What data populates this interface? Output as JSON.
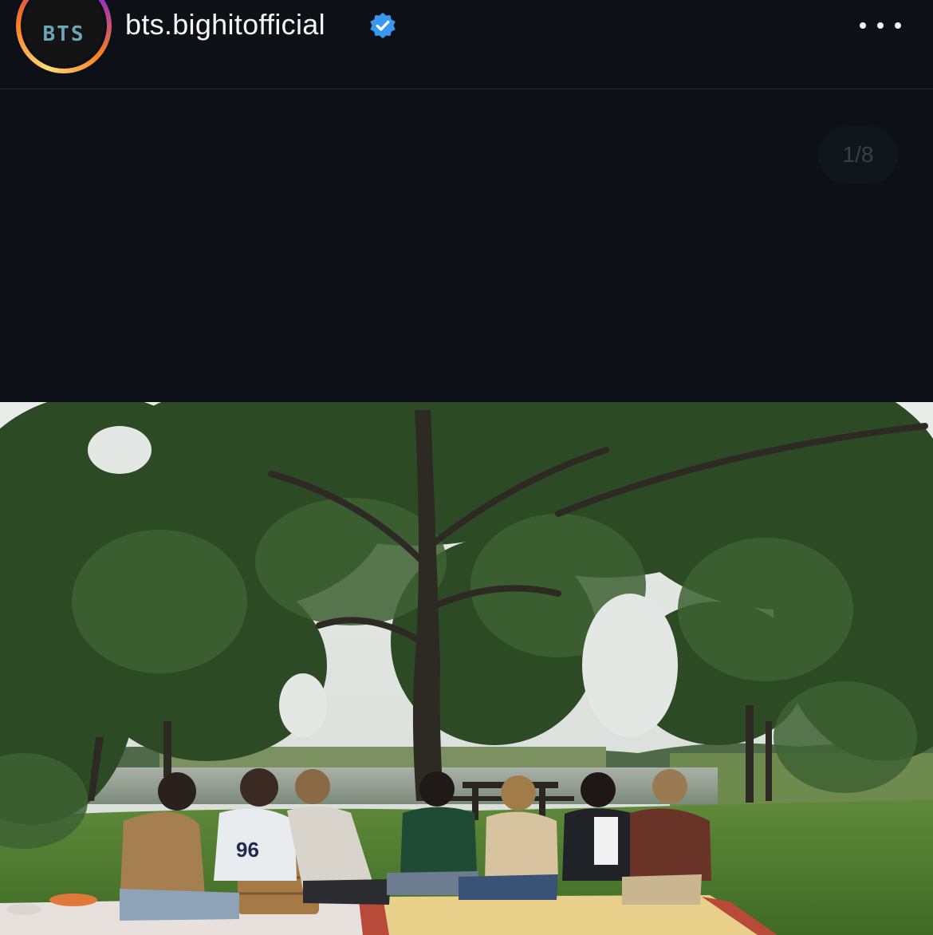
{
  "header": {
    "username": "bts.bighitofficial",
    "avatar_text": "BTS",
    "verified": true,
    "verified_icon": "verified-badge-icon",
    "more_icon": "more-options-icon"
  },
  "carousel": {
    "counter": "1/8"
  },
  "colors": {
    "background": "#0d1117",
    "verified_blue": "#3897f0",
    "text": "#f5f5f5"
  }
}
